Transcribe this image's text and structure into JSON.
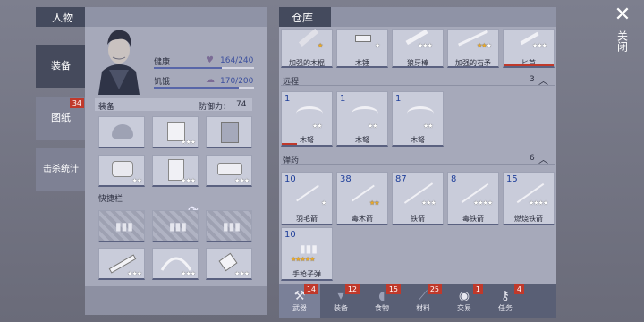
{
  "left": {
    "title": "人物",
    "tabs": [
      {
        "label": "装备"
      },
      {
        "label": "图纸",
        "badge": "34"
      },
      {
        "label": "击杀统计"
      }
    ],
    "health_label": "健康",
    "health_value": "164/240",
    "hunger_label": "饥饿",
    "hunger_value": "170/200",
    "equip_label": "装备",
    "defense_label": "防御力：",
    "defense_value": "74",
    "hotbar_label": "快捷栏",
    "equip_slots": [
      {
        "icon": "hat-icon",
        "stars": 0
      },
      {
        "icon": "jacket-icon",
        "stars": 3
      },
      {
        "icon": "backpack-icon",
        "stars": 0
      },
      {
        "icon": "gloves-icon",
        "stars": 2
      },
      {
        "icon": "pants-icon",
        "stars": 3
      },
      {
        "icon": "boots-icon",
        "stars": 3
      }
    ],
    "hotbar_slots": [
      {
        "icon": "ammo-icon",
        "stars": 0
      },
      {
        "icon": "ammo-icon",
        "stars": 0
      },
      {
        "icon": "ammo-icon",
        "stars": 0
      },
      {
        "icon": "machete-icon",
        "stars": 3
      },
      {
        "icon": "bow-icon",
        "stars": 3
      },
      {
        "icon": "cleaver-icon",
        "stars": 3
      }
    ]
  },
  "right": {
    "title": "仓库",
    "melee": [
      {
        "name": "加强的木棍",
        "stars": "1g"
      },
      {
        "name": "木锤",
        "stars": "1"
      },
      {
        "name": "狼牙棒",
        "stars": "3"
      },
      {
        "name": "加强的石矛",
        "stars": "2g1"
      },
      {
        "name": "匕首",
        "stars": "3"
      }
    ],
    "ranged_header": "远程",
    "ranged_count": "3",
    "ranged": [
      {
        "count": "1",
        "name": "木弩",
        "stars": "2"
      },
      {
        "count": "1",
        "name": "木弩",
        "stars": "2"
      },
      {
        "count": "1",
        "name": "木弩",
        "stars": "2"
      }
    ],
    "ammo_header": "弹药",
    "ammo_count": "6",
    "ammo": [
      {
        "count": "10",
        "name": "羽毛箭",
        "stars": "1"
      },
      {
        "count": "38",
        "name": "毒木箭",
        "stars": "2g"
      },
      {
        "count": "87",
        "name": "铁箭",
        "stars": "3"
      },
      {
        "count": "8",
        "name": "毒铁箭",
        "stars": "4"
      },
      {
        "count": "15",
        "name": "燃烧铁箭",
        "stars": "4"
      },
      {
        "count": "10",
        "name": "手枪子弹",
        "stars": "5g"
      }
    ],
    "bottom_tabs": [
      {
        "label": "武器",
        "badge": "14"
      },
      {
        "label": "装备",
        "badge": "12"
      },
      {
        "label": "食物",
        "badge": "15"
      },
      {
        "label": "材料",
        "badge": "25"
      },
      {
        "label": "交易",
        "badge": "1"
      },
      {
        "label": "任务",
        "badge": "4"
      }
    ]
  },
  "close_label": "关闭"
}
